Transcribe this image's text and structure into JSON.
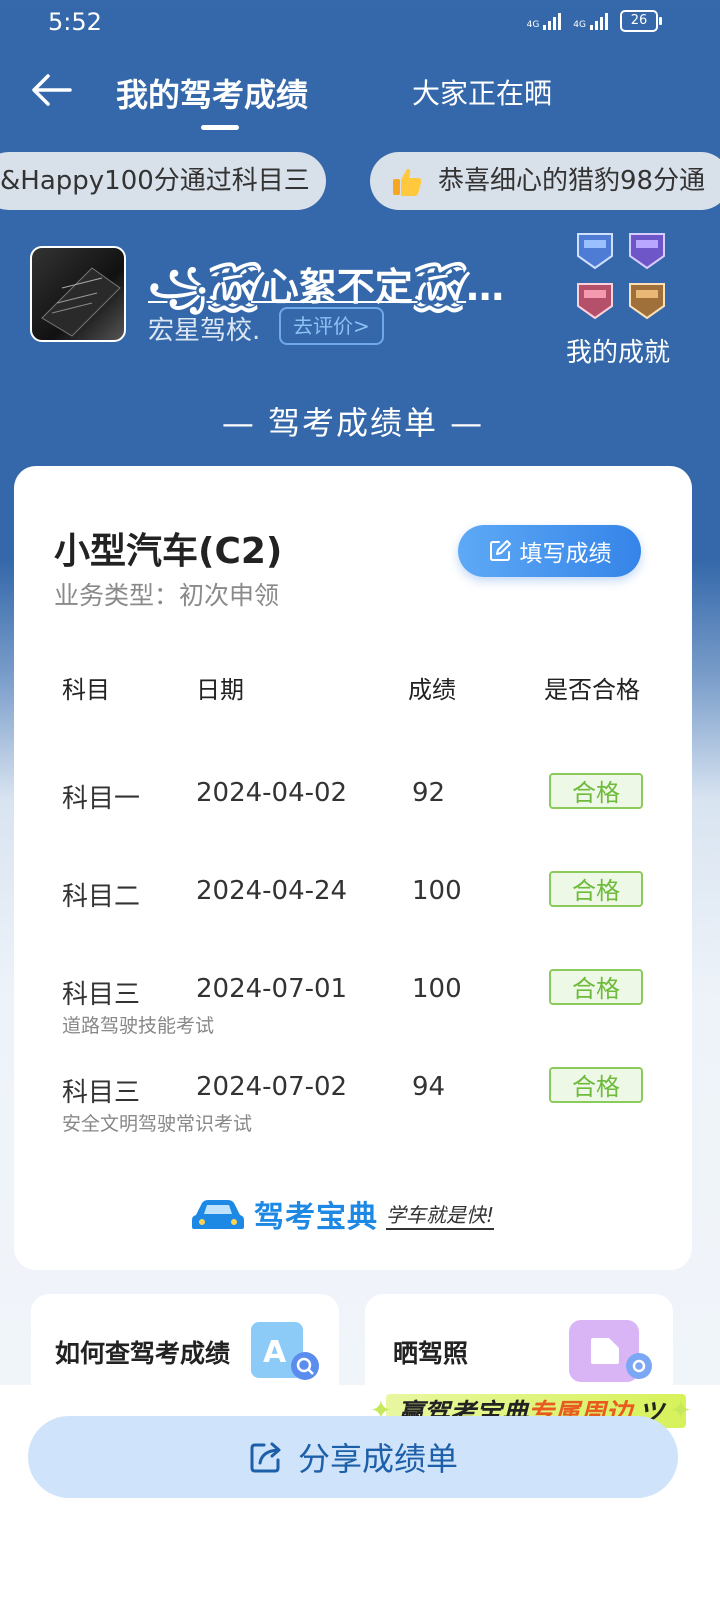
{
  "status_bar": {
    "time": "5:52",
    "battery": "26"
  },
  "header": {
    "title": "我的驾考成绩",
    "tab2": "大家正在晒"
  },
  "ticker": [
    {
      "text": "&Happy100分通过科目三"
    },
    {
      "text": "恭喜细心的猎豹98分通"
    }
  ],
  "profile": {
    "nickname": "꧁꫞心絮不定꫞꧂…",
    "school": "宏星驾校.",
    "review_label": "去评价>",
    "achievements_label": "我的成就"
  },
  "section_title": "— 驾考成绩单 —",
  "card": {
    "car_type": "小型汽车(C2)",
    "biz_type": "业务类型：初次申领",
    "fill_label": "填写成绩",
    "headers": [
      "科目",
      "日期",
      "成绩",
      "是否合格"
    ],
    "rows": [
      {
        "subject": "科目一",
        "date": "2024-04-02",
        "score": "92",
        "result": "合格",
        "note": ""
      },
      {
        "subject": "科目二",
        "date": "2024-04-24",
        "score": "100",
        "result": "合格",
        "note": ""
      },
      {
        "subject": "科目三",
        "date": "2024-07-01",
        "score": "100",
        "result": "合格",
        "note": "道路驾驶技能考试"
      },
      {
        "subject": "科目三",
        "date": "2024-07-02",
        "score": "94",
        "result": "合格",
        "note": "安全文明驾驶常识考试"
      }
    ],
    "brand_name": "驾考宝典",
    "brand_slogan": "学车就是快!"
  },
  "bottom": {
    "card1_label": "如何查驾考成绩",
    "card2_label": "晒驾照",
    "promo_a": "赢驾考宝典",
    "promo_b": "专属周边",
    "share_label": "分享成绩单"
  },
  "colors": {
    "primary_bg": "#3468AA",
    "pass_green": "#6EBB3C",
    "accent_blue": "#3584E8"
  }
}
